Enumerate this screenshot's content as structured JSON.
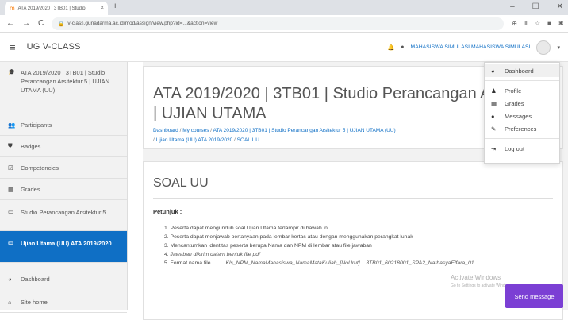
{
  "browser": {
    "tab_title": "ATA 2019/2020 | 3TB01 | Studio",
    "url": "v-class.gunadarma.ac.id/mod/assign/view.php?id=...&action=view"
  },
  "navbar": {
    "site_name": "UG V-CLASS",
    "user_name": "MAHASISWA SIMULASI MAHASISWA SIMULASI"
  },
  "drawer": {
    "items": [
      {
        "icon": "graduation-cap-icon",
        "glyph": "🎓",
        "label": "ATA 2019/2020 | 3TB01 | Studio Perancangan Arsitektur 5 | UJIAN UTAMA (UU)"
      },
      {
        "icon": "users-icon",
        "glyph": "👥",
        "label": "Participants"
      },
      {
        "icon": "shield-icon",
        "glyph": "⛊",
        "label": "Badges"
      },
      {
        "icon": "check-square-icon",
        "glyph": "☑",
        "label": "Competencies"
      },
      {
        "icon": "table-icon",
        "glyph": "▦",
        "label": "Grades"
      },
      {
        "icon": "folder-icon",
        "glyph": "▭",
        "label": "Studio Perancangan Arsitektur 5"
      },
      {
        "icon": "folder-icon",
        "glyph": "▭",
        "label": "Ujian Utama (UU) ATA 2019/2020"
      },
      {
        "icon": "dashboard-icon",
        "glyph": "◕",
        "label": "Dashboard"
      },
      {
        "icon": "home-icon",
        "glyph": "⌂",
        "label": "Site home"
      }
    ]
  },
  "main": {
    "title": "ATA 2019/2020 | 3TB01 | Studio Perancangan Arsitektur 5 | UJIAN UTAMA",
    "breadcrumb": [
      "Dashboard",
      "My courses",
      "ATA 2019/2020 | 3TB01 | Studio Perancangan Arsitektur 5 | UJIAN UTAMA (UU)",
      "Ujian Utama (UU) ATA 2019/2020",
      "SOAL UU"
    ],
    "section_title": "SOAL UU",
    "petunjuk": "Petunjuk :",
    "instructions": [
      "1. Peserta dapat mengunduh soal Ujian Utama terlampir di bawah ini",
      "2. Peserta dapat menjawab pertanyaan pada lembar kertas atau dengan menggunakan perangkat lunak",
      "3. Mencantumkan identitas peserta berupa Nama dan NPM di lembar atau file jawaban",
      "4. Jawaban dikirim dalam bentuk file pdf",
      "5. Format nama file :",
      "Kls_NPM_NamaMahasiswa_NamaMataKuliah_[NoUrut]",
      "3TB01_60218001_SPA2_NathasyaElfara_01"
    ]
  },
  "watermark": {
    "line1": "Activate Windows",
    "line2": "Go to Settings to activate Windows."
  },
  "send_message": "Send message",
  "user_menu": {
    "items": [
      {
        "icon": "dashboard-icon",
        "glyph": "◕",
        "label": "Dashboard"
      },
      {
        "icon": "user-icon",
        "glyph": "♟",
        "label": "Profile"
      },
      {
        "icon": "table-icon",
        "glyph": "▦",
        "label": "Grades"
      },
      {
        "icon": "comment-icon",
        "glyph": "●",
        "label": "Messages"
      },
      {
        "icon": "wrench-icon",
        "glyph": "✎",
        "label": "Preferences"
      },
      {
        "icon": "logout-icon",
        "glyph": "⇥",
        "label": "Log out"
      }
    ]
  }
}
